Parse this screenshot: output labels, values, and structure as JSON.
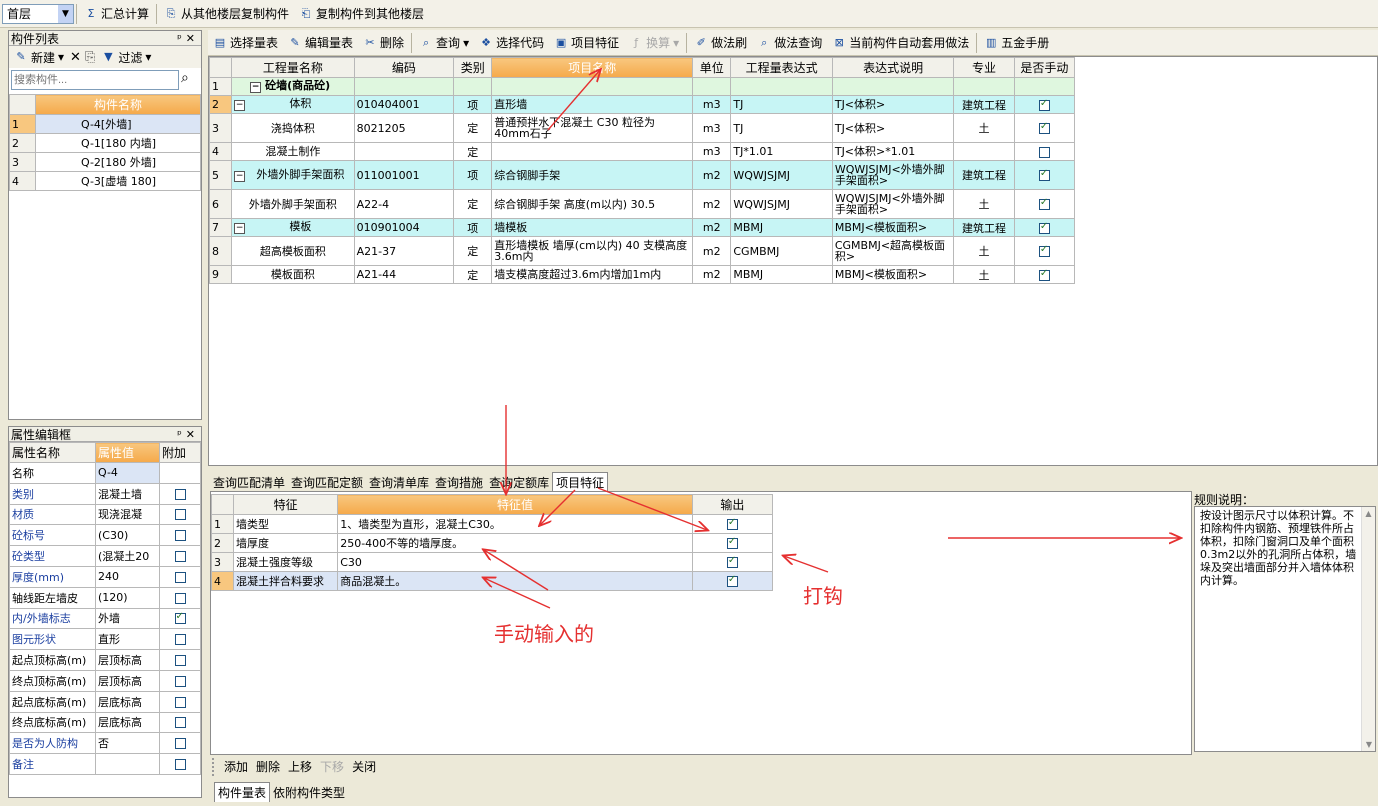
{
  "top_toolbar": {
    "floor_select": "首层",
    "summary": "汇总计算",
    "copy_from": "从其他楼层复制构件",
    "copy_to": "复制构件到其他楼层"
  },
  "component_list": {
    "title": "构件列表",
    "new": "新建",
    "filter": "过滤",
    "search_placeholder": "搜索构件...",
    "col_name": "构件名称",
    "items": [
      {
        "no": "1",
        "name": "Q-4[外墙]"
      },
      {
        "no": "2",
        "name": "Q-1[180 内墙]"
      },
      {
        "no": "3",
        "name": "Q-2[180 外墙]"
      },
      {
        "no": "4",
        "name": "Q-3[虚墙 180]"
      }
    ]
  },
  "property_box": {
    "title": "属性编辑框",
    "col_name": "属性名称",
    "col_value": "属性值",
    "col_attach": "附加",
    "rows": [
      {
        "name": "名称",
        "value": "Q-4",
        "blue": false,
        "attach": null
      },
      {
        "name": "类别",
        "value": "混凝土墙",
        "blue": true,
        "attach": false
      },
      {
        "name": "材质",
        "value": "现浇混凝",
        "blue": true,
        "attach": false
      },
      {
        "name": "砼标号",
        "value": "(C30)",
        "blue": true,
        "attach": false
      },
      {
        "name": "砼类型",
        "value": "(混凝土20",
        "blue": true,
        "attach": false
      },
      {
        "name": "厚度(mm)",
        "value": "240",
        "blue": true,
        "attach": false
      },
      {
        "name": "轴线距左墙皮",
        "value": "(120)",
        "blue": false,
        "attach": false
      },
      {
        "name": "内/外墙标志",
        "value": "外墙",
        "blue": true,
        "attach": true
      },
      {
        "name": "图元形状",
        "value": "直形",
        "blue": true,
        "attach": false
      },
      {
        "name": "起点顶标高(m)",
        "value": "层顶标高",
        "blue": false,
        "attach": false
      },
      {
        "name": "终点顶标高(m)",
        "value": "层顶标高",
        "blue": false,
        "attach": false
      },
      {
        "name": "起点底标高(m)",
        "value": "层底标高",
        "blue": false,
        "attach": false
      },
      {
        "name": "终点底标高(m)",
        "value": "层底标高",
        "blue": false,
        "attach": false
      },
      {
        "name": "是否为人防构",
        "value": "否",
        "blue": true,
        "attach": false
      },
      {
        "name": "备注",
        "value": "",
        "blue": true,
        "attach": false
      }
    ]
  },
  "main_toolbar": {
    "select_list": "选择量表",
    "edit_list": "编辑量表",
    "delete": "删除",
    "query": "查询",
    "select_code": "选择代码",
    "item_feature": "项目特征",
    "convert": "换算",
    "method_brush": "做法刷",
    "method_query": "做法查询",
    "auto_apply": "当前构件自动套用做法",
    "hardware": "五金手册"
  },
  "main_grid": {
    "headers": [
      "工程量名称",
      "编码",
      "类别",
      "项目名称",
      "单位",
      "工程量表达式",
      "表达式说明",
      "专业",
      "是否手动"
    ],
    "rows": [
      {
        "no": "1",
        "name": "砼墙(商品砼)",
        "code": "",
        "type": "",
        "item": "",
        "unit": "",
        "expr": "",
        "desc": "",
        "major": "",
        "manual": null,
        "kind": "g"
      },
      {
        "no": "2",
        "name": "体积",
        "code": "010404001",
        "type": "项",
        "item": "直形墙",
        "unit": "m3",
        "expr": "TJ",
        "desc": "TJ<体积>",
        "major": "建筑工程",
        "manual": true,
        "kind": "h"
      },
      {
        "no": "3",
        "name": "浇捣体积",
        "code": "8021205",
        "type": "定",
        "item": "普通预拌水下混凝土 C30 粒径为40mm石子",
        "unit": "m3",
        "expr": "TJ",
        "desc": "TJ<体积>",
        "major": "土",
        "manual": true,
        "kind": ""
      },
      {
        "no": "4",
        "name": "混凝土制作",
        "code": "",
        "type": "定",
        "item": "",
        "unit": "m3",
        "expr": "TJ*1.01",
        "desc": "TJ<体积>*1.01",
        "major": "",
        "manual": false,
        "kind": ""
      },
      {
        "no": "5",
        "name": "外墙外脚手架面积",
        "code": "011001001",
        "type": "项",
        "item": "综合钢脚手架",
        "unit": "m2",
        "expr": "WQWJSJMJ",
        "desc": "WQWJSJMJ<外墙外脚手架面积>",
        "major": "建筑工程",
        "manual": true,
        "kind": "h"
      },
      {
        "no": "6",
        "name": "外墙外脚手架面积",
        "code": "A22-4",
        "type": "定",
        "item": "综合钢脚手架 高度(m以内) 30.5",
        "unit": "m2",
        "expr": "WQWJSJMJ",
        "desc": "WQWJSJMJ<外墙外脚手架面积>",
        "major": "土",
        "manual": true,
        "kind": ""
      },
      {
        "no": "7",
        "name": "模板",
        "code": "010901004",
        "type": "项",
        "item": "墙模板",
        "unit": "m2",
        "expr": "MBMJ",
        "desc": "MBMJ<模板面积>",
        "major": "建筑工程",
        "manual": true,
        "kind": "h"
      },
      {
        "no": "8",
        "name": "超高模板面积",
        "code": "A21-37",
        "type": "定",
        "item": "直形墙模板 墙厚(cm以内) 40 支模高度3.6m内",
        "unit": "m2",
        "expr": "CGMBMJ",
        "desc": "CGMBMJ<超高模板面积>",
        "major": "土",
        "manual": true,
        "kind": ""
      },
      {
        "no": "9",
        "name": "模板面积",
        "code": "A21-44",
        "type": "定",
        "item": "墙支模高度超过3.6m内增加1m内",
        "unit": "m2",
        "expr": "MBMJ",
        "desc": "MBMJ<模板面积>",
        "major": "土",
        "manual": true,
        "kind": ""
      }
    ]
  },
  "bottom_tabs": [
    "查询匹配清单",
    "查询匹配定额",
    "查询清单库",
    "查询措施",
    "查询定额库",
    "项目特征"
  ],
  "feature_grid": {
    "headers": [
      "特征",
      "特征值",
      "输出"
    ],
    "rows": [
      {
        "no": "1",
        "feature": "墙类型",
        "value": "1、墙类型为直形，混凝土C30。",
        "out": true
      },
      {
        "no": "2",
        "feature": "墙厚度",
        "value": "250-400不等的墙厚度。",
        "out": true
      },
      {
        "no": "3",
        "feature": "混凝土强度等级",
        "value": "C30",
        "out": true
      },
      {
        "no": "4",
        "feature": "混凝土拌合料要求",
        "value": "商品混凝土。",
        "out": true
      }
    ]
  },
  "rule": {
    "title": "规则说明：",
    "text": "按设计图示尺寸以体积计算。不扣除构件内钢筋、预埋铁件所占体积，扣除门窗洞口及单个面积0.3m2以外的孔洞所占体积，墙垛及突出墙面部分并入墙体体积内计算。"
  },
  "feature_actions": {
    "add": "添加",
    "delete": "删除",
    "up": "上移",
    "down": "下移",
    "close": "关闭"
  },
  "footer_tabs": [
    "构件量表",
    "依附构件类型"
  ],
  "annotations": {
    "manual": "手动输入的",
    "check": "打钩"
  }
}
